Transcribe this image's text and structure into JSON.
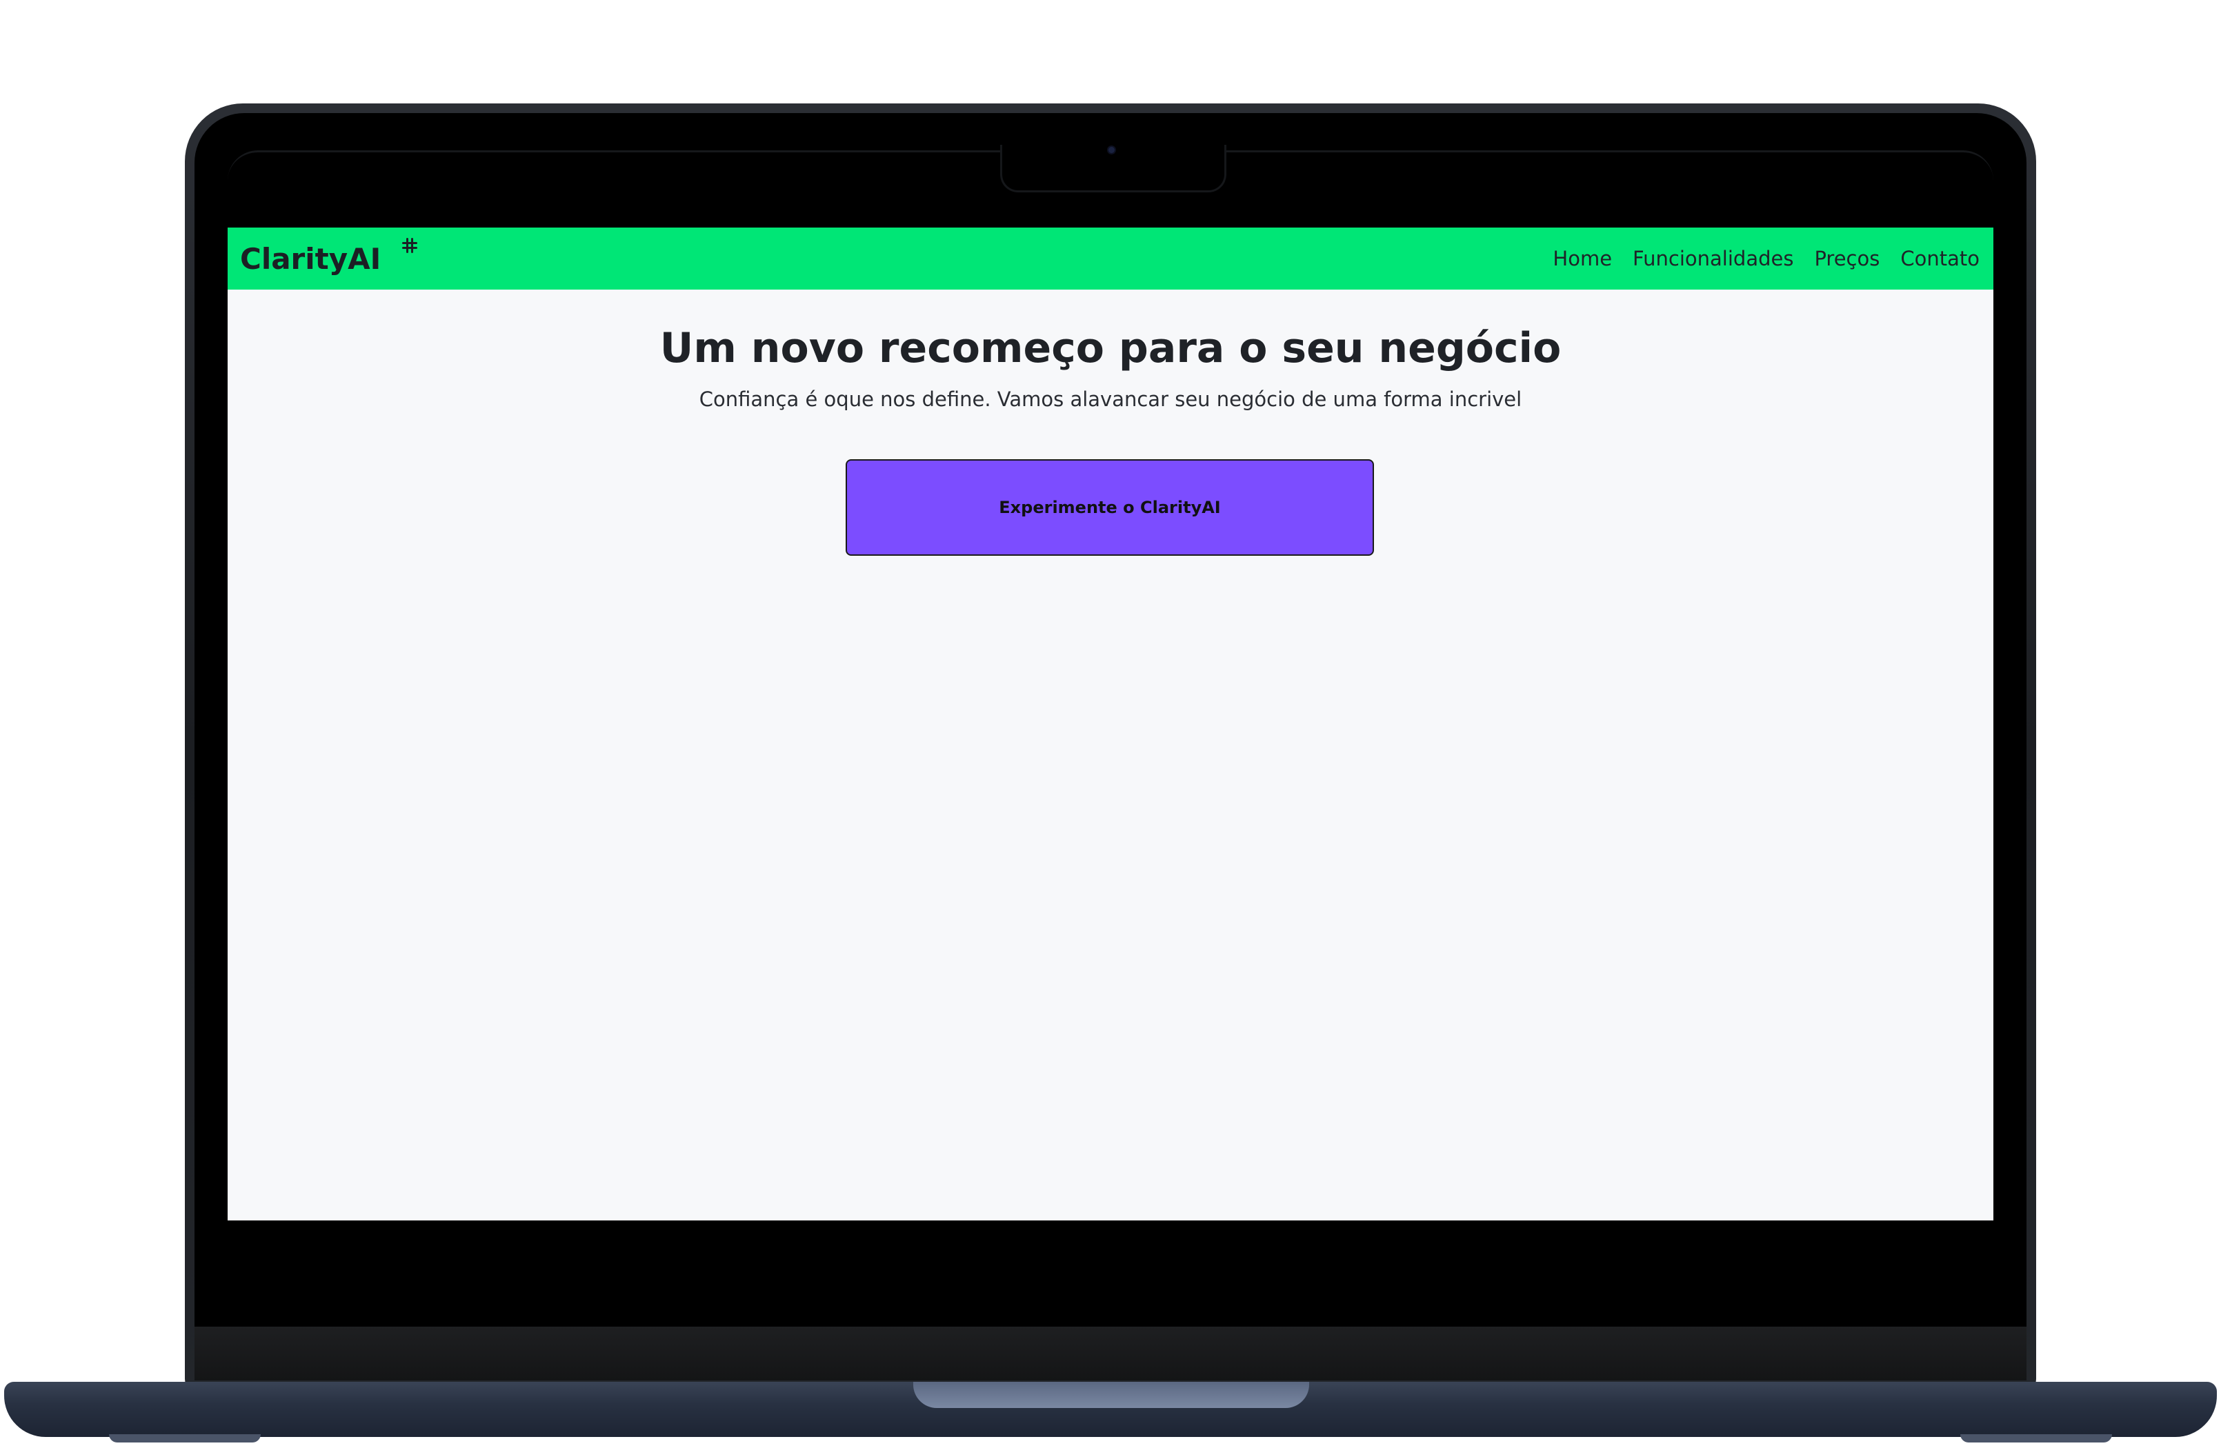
{
  "navbar": {
    "brand": "ClarityAI",
    "brand_icon": "slack-like-hash-icon",
    "links": [
      "Home",
      "Funcionalidades",
      "Preços",
      "Contato"
    ],
    "background_color": "#00e676"
  },
  "hero": {
    "title": "Um novo recomeço para o seu negócio",
    "subtitle": "Confiança é oque nos define. Vamos alavancar seu negócio de uma forma incrivel",
    "cta_label": "Experimente o ClarityAI",
    "cta_color": "#7c4dff"
  },
  "page": {
    "background_color": "#f7f8fa"
  }
}
